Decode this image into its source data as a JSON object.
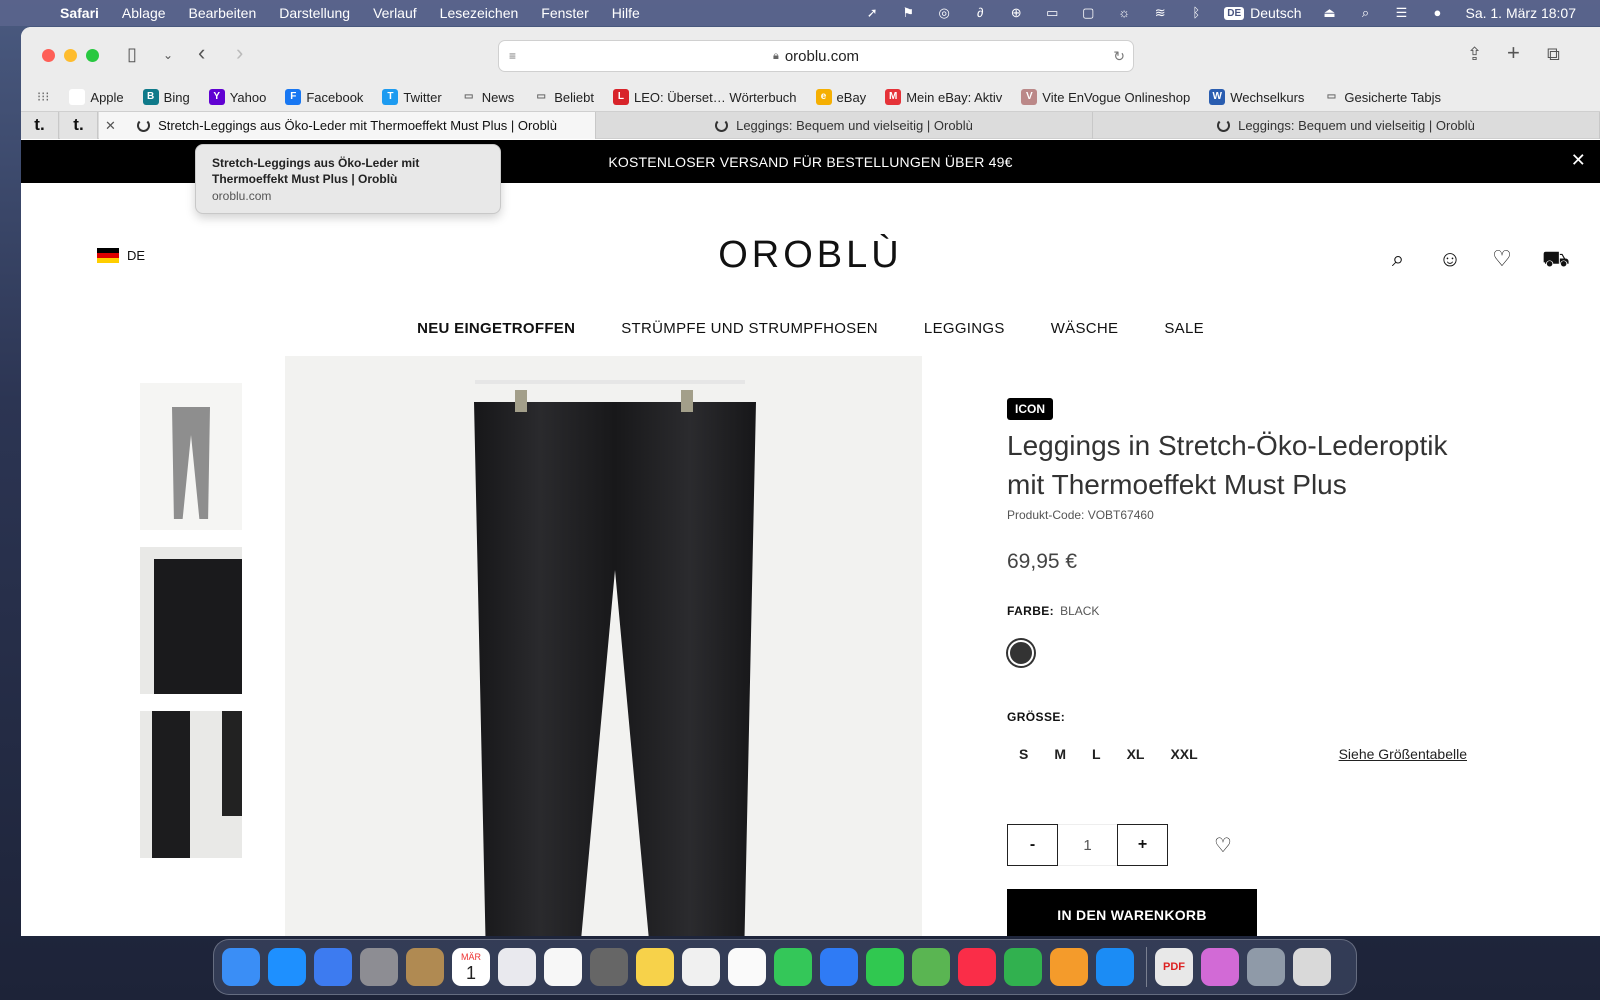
{
  "menubar": {
    "app": "Safari",
    "items": [
      "Ablage",
      "Bearbeiten",
      "Darstellung",
      "Verlauf",
      "Lesezeichen",
      "Fenster",
      "Hilfe"
    ],
    "input_source": "DE",
    "language": "Deutsch",
    "datetime": "Sa. 1. März  18:07"
  },
  "browser": {
    "url": "oroblu.com",
    "bookmarks": [
      {
        "label": "Apple",
        "icon": "apple-icon",
        "color": "#ffffff"
      },
      {
        "label": "Bing",
        "icon": "bing-icon",
        "color": "#0f7a8a"
      },
      {
        "label": "Yahoo",
        "icon": "yahoo-icon",
        "color": "#6001d2"
      },
      {
        "label": "Facebook",
        "icon": "facebook-icon",
        "color": "#1877f2"
      },
      {
        "label": "Twitter",
        "icon": "twitter-icon",
        "color": "#1d9bf0"
      },
      {
        "label": "News",
        "icon": "folder-icon",
        "color": "#ececec"
      },
      {
        "label": "Beliebt",
        "icon": "folder-icon",
        "color": "#ececec"
      },
      {
        "label": "LEO: Überset… Wörterbuch",
        "icon": "leo-icon",
        "color": "#d8232a"
      },
      {
        "label": "eBay",
        "icon": "ebay-icon",
        "color": "#f5af02"
      },
      {
        "label": "Mein eBay: Aktiv",
        "icon": "ebay-flag-icon",
        "color": "#e53238"
      },
      {
        "label": "Vite EnVogue Onlineshop",
        "icon": "vite-icon",
        "color": "#b88"
      },
      {
        "label": "Wechselkurs",
        "icon": "chart-icon",
        "color": "#2a5db0"
      },
      {
        "label": "Gesicherte Tabjs",
        "icon": "folder-icon",
        "color": "#ececec"
      }
    ],
    "pinned_tabs": [
      "t.",
      "t."
    ],
    "tabs": [
      {
        "label": "Stretch-Leggings aus Öko-Leder mit Thermoeffekt Must Plus | Oroblù",
        "active": true
      },
      {
        "label": "Leggings: Bequem und vielseitig | Oroblù",
        "active": false
      },
      {
        "label": "Leggings: Bequem und vielseitig | Oroblù",
        "active": false
      }
    ],
    "tooltip": {
      "title": "Stretch-Leggings aus Öko-Leder mit Thermoeffekt Must Plus | Oroblù",
      "url": "oroblu.com"
    }
  },
  "site": {
    "banner": "KOSTENLOSER VERSAND FÜR BESTELLUNGEN ÜBER 49€",
    "lang": "DE",
    "logo": "OROBLÙ",
    "nav": [
      "NEU EINGETROFFEN",
      "STRÜMPFE UND STRUMPFHOSEN",
      "LEGGINGS",
      "WÄSCHE",
      "SALE"
    ]
  },
  "product": {
    "badge": "ICON",
    "title": "Leggings in Stretch-Öko-Lederoptik mit Thermoeffekt Must Plus",
    "code": "Produkt-Code: VOBT67460",
    "price": "69,95 €",
    "color_label": "FARBE:",
    "color_value": "BLACK",
    "swatch_color": "#333333",
    "size_label": "GRÖSSE:",
    "sizes": [
      "S",
      "M",
      "L",
      "XL",
      "XXL"
    ],
    "size_chart": "Siehe Größentabelle",
    "qty_minus": "-",
    "qty": "1",
    "qty_plus": "+",
    "cart": "IN DEN WARENKORB"
  },
  "dock": [
    "Finder",
    "Safari",
    "Mail",
    "Systemeinstellungen",
    "Kontakte",
    "Kalender",
    "Launchpad",
    "Fotos",
    "Rechner",
    "Notizen",
    "Freeform",
    "Erinnerungen",
    "Nachrichten",
    "Keynote",
    "FaceTime",
    "Karten",
    "Musik",
    "Numbers",
    "Pages",
    "App Store",
    "PDF",
    "Vorschau",
    "Bildschirmfoto",
    "Papierkorb"
  ],
  "dock_calendar": {
    "month": "MÄR",
    "day": "1"
  }
}
